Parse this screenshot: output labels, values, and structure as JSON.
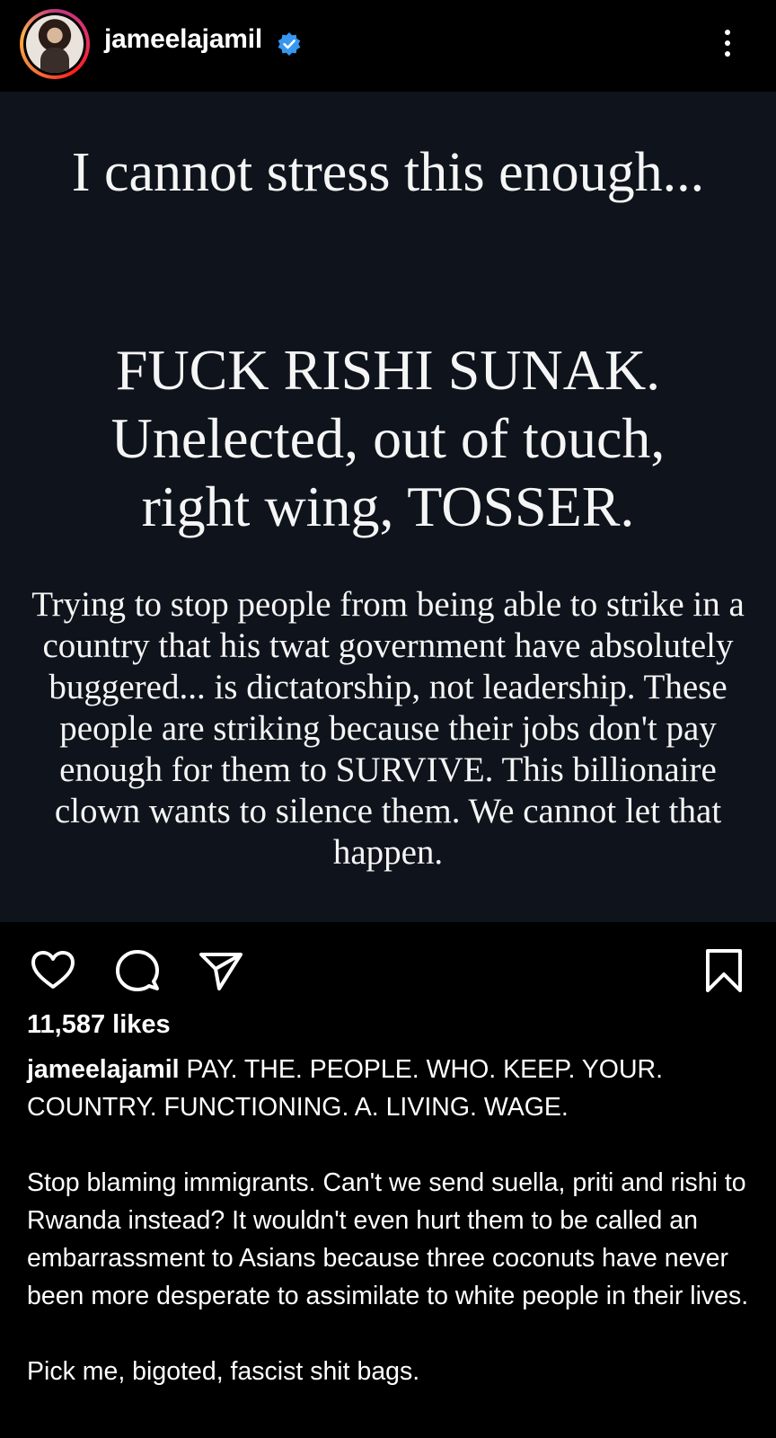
{
  "header": {
    "username": "jameelajamil",
    "verified_icon": "verified-badge-icon",
    "more_icon": "more-vertical-icon"
  },
  "post_image": {
    "headline": "I cannot stress this enough...",
    "shout_line_1": "FUCK RISHI SUNAK.",
    "shout_line_2": "Unelected, out of touch,",
    "shout_line_3": "right wing, TOSSER.",
    "body": "Trying to stop people from being able to strike in a country that his twat government have absolutely buggered... is dictatorship, not leadership. These people are striking because their jobs don't pay enough for them to SURVIVE. This billionaire clown wants to silence them. We cannot let that happen."
  },
  "actions": {
    "like_icon": "heart-icon",
    "comment_icon": "comment-bubble-icon",
    "share_icon": "send-paper-plane-icon",
    "save_icon": "bookmark-icon"
  },
  "likes": "11,587 likes",
  "caption": {
    "username": "jameelajamil",
    "line_1": "PAY. THE. PEOPLE. WHO. KEEP. YOUR. COUNTRY. FUNCTIONING. A. LIVING. WAGE.",
    "paragraph_2": "Stop blaming immigrants. Can't we send suella, priti and rishi to Rwanda instead? It wouldn't even hurt them to be called an embarrassment to Asians because three coconuts have never been more desperate to assimilate to white people in their lives.",
    "paragraph_3": "Pick me, bigoted, fascist shit bags."
  },
  "colors": {
    "background": "#000000",
    "post_background": "#0f141c",
    "text": "#ffffff",
    "verified": "#3897f0"
  }
}
